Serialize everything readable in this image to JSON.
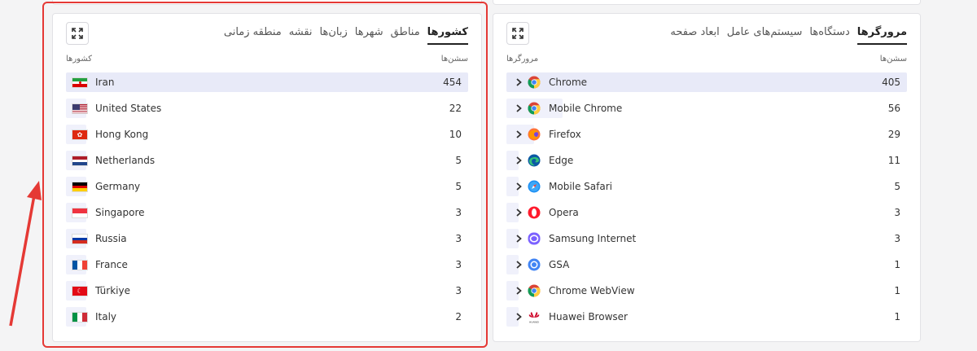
{
  "left_panel": {
    "tabs": [
      "کشورها",
      "مناطق",
      "شهرها",
      "زبان‌ها",
      "نقشه",
      "منطقه زمانی"
    ],
    "active_tab": 0,
    "col_left": "کشورها",
    "col_right": "سشن‌ها",
    "rows": [
      {
        "name": "Iran",
        "count": "454",
        "flag": "ir",
        "share": 1.0
      },
      {
        "name": "United States",
        "count": "22",
        "flag": "us",
        "share": 0.05
      },
      {
        "name": "Hong Kong",
        "count": "10",
        "flag": "hk",
        "share": 0.03
      },
      {
        "name": "Netherlands",
        "count": "5",
        "flag": "nl",
        "share": 0.02
      },
      {
        "name": "Germany",
        "count": "5",
        "flag": "de",
        "share": 0.02
      },
      {
        "name": "Singapore",
        "count": "3",
        "flag": "sg",
        "share": 0.015
      },
      {
        "name": "Russia",
        "count": "3",
        "flag": "ru",
        "share": 0.015
      },
      {
        "name": "France",
        "count": "3",
        "flag": "fr",
        "share": 0.015
      },
      {
        "name": "Türkiye",
        "count": "3",
        "flag": "tr",
        "share": 0.015
      },
      {
        "name": "Italy",
        "count": "2",
        "flag": "it",
        "share": 0.01
      }
    ]
  },
  "right_panel": {
    "tabs": [
      "مرورگرها",
      "دستگاه‌ها",
      "سیستم‌های عامل",
      "ابعاد صفحه"
    ],
    "active_tab": 0,
    "col_left": "مرورگرها",
    "col_right": "سشن‌ها",
    "rows": [
      {
        "name": "Chrome",
        "count": "405",
        "icon": "chrome",
        "share": 1.0
      },
      {
        "name": "Mobile Chrome",
        "count": "56",
        "icon": "chrome",
        "share": 0.14
      },
      {
        "name": "Firefox",
        "count": "29",
        "icon": "firefox",
        "share": 0.07
      },
      {
        "name": "Edge",
        "count": "11",
        "icon": "edge",
        "share": 0.03
      },
      {
        "name": "Mobile Safari",
        "count": "5",
        "icon": "safari",
        "share": 0.015
      },
      {
        "name": "Opera",
        "count": "3",
        "icon": "opera",
        "share": 0.01
      },
      {
        "name": "Samsung Internet",
        "count": "3",
        "icon": "samsung",
        "share": 0.01
      },
      {
        "name": "GSA",
        "count": "1",
        "icon": "gsa",
        "share": 0.005
      },
      {
        "name": "Chrome WebView",
        "count": "1",
        "icon": "chrome",
        "share": 0.005
      },
      {
        "name": "Huawei Browser",
        "count": "1",
        "icon": "huawei",
        "share": 0.005
      }
    ]
  },
  "colors": {
    "highlight": "#e53935",
    "first_row_bg": "#e8eaf8",
    "bar_bg": "#f0f1fb"
  }
}
